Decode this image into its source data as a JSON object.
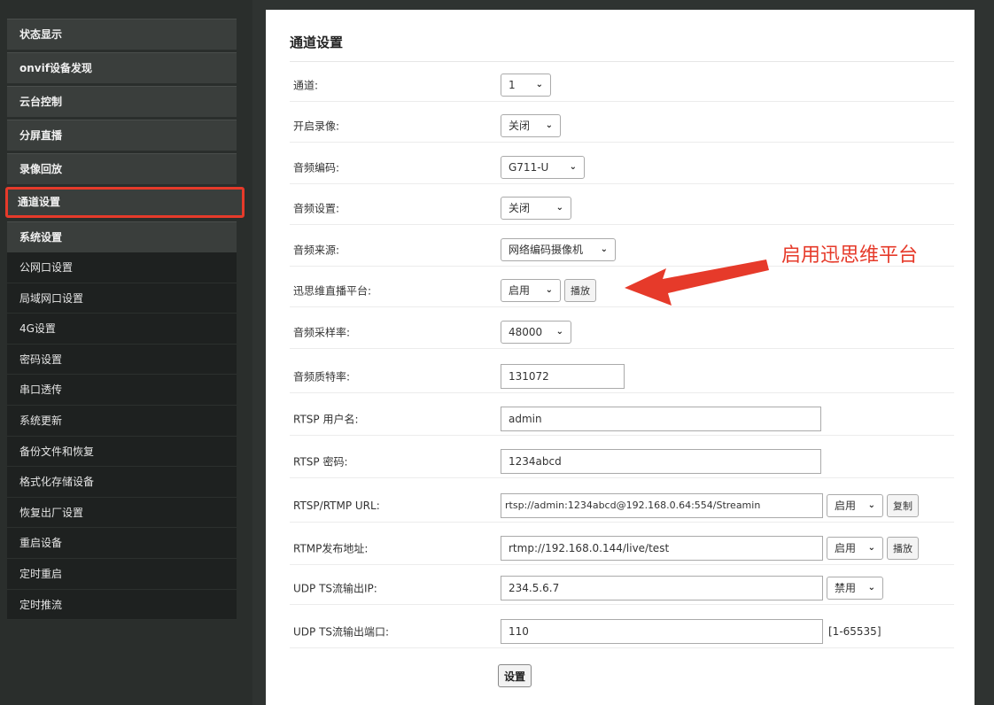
{
  "sidebar": {
    "top_items": [
      {
        "label": "状态显示"
      },
      {
        "label": "onvif设备发现"
      },
      {
        "label": "云台控制"
      },
      {
        "label": "分屏直播"
      },
      {
        "label": "录像回放"
      },
      {
        "label": "通道设置"
      },
      {
        "label": "系统设置"
      }
    ],
    "sub_items": [
      {
        "label": "公网口设置"
      },
      {
        "label": "局域网口设置"
      },
      {
        "label": "4G设置"
      },
      {
        "label": "密码设置"
      },
      {
        "label": "串口透传"
      },
      {
        "label": "系统更新"
      },
      {
        "label": "备份文件和恢复"
      },
      {
        "label": "格式化存储设备"
      },
      {
        "label": "恢复出厂设置"
      },
      {
        "label": "重启设备"
      },
      {
        "label": "定时重启"
      },
      {
        "label": "定时推流"
      }
    ],
    "active_item": "通道设置"
  },
  "main": {
    "title": "通道设置",
    "rows": {
      "channel": {
        "label": "通道:",
        "value": "1"
      },
      "recording": {
        "label": "开启录像:",
        "value": "关闭"
      },
      "audio_codec": {
        "label": "音频编码:",
        "value": "G711-U"
      },
      "audio_setting": {
        "label": "音频设置:",
        "value": "关闭"
      },
      "audio_source": {
        "label": "音频来源:",
        "value": "网络编码摄像机"
      },
      "live_platform": {
        "label": "迅思维直播平台:",
        "value": "启用",
        "button": "播放"
      },
      "sample_rate": {
        "label": "音频采样率:",
        "value": "48000"
      },
      "bitrate": {
        "label": "音频质特率:",
        "value": "131072"
      },
      "rtsp_user": {
        "label": "RTSP 用户名:",
        "value": "admin"
      },
      "rtsp_pass": {
        "label": "RTSP 密码:",
        "value": "1234abcd"
      },
      "rtsp_url": {
        "label": "RTSP/RTMP URL:",
        "value": "rtsp://admin:1234abcd@192.168.0.64:554/Streamin",
        "select": "启用",
        "button": "复制"
      },
      "rtmp_addr": {
        "label": "RTMP发布地址:",
        "value": "rtmp://192.168.0.144/live/test",
        "select": "启用",
        "button": "播放"
      },
      "udp_ip": {
        "label": "UDP TS流输出IP:",
        "value": "234.5.6.7",
        "select": "禁用"
      },
      "udp_port": {
        "label": "UDP TS流输出端口:",
        "value": "110",
        "range": "[1-65535]"
      }
    },
    "submit": "设置"
  },
  "annotation": {
    "text": "启用迅思维平台",
    "color": "#e63a2a"
  },
  "colors": {
    "accent": "#e63a2a",
    "sidebar_bg": "#2a2e2c"
  }
}
